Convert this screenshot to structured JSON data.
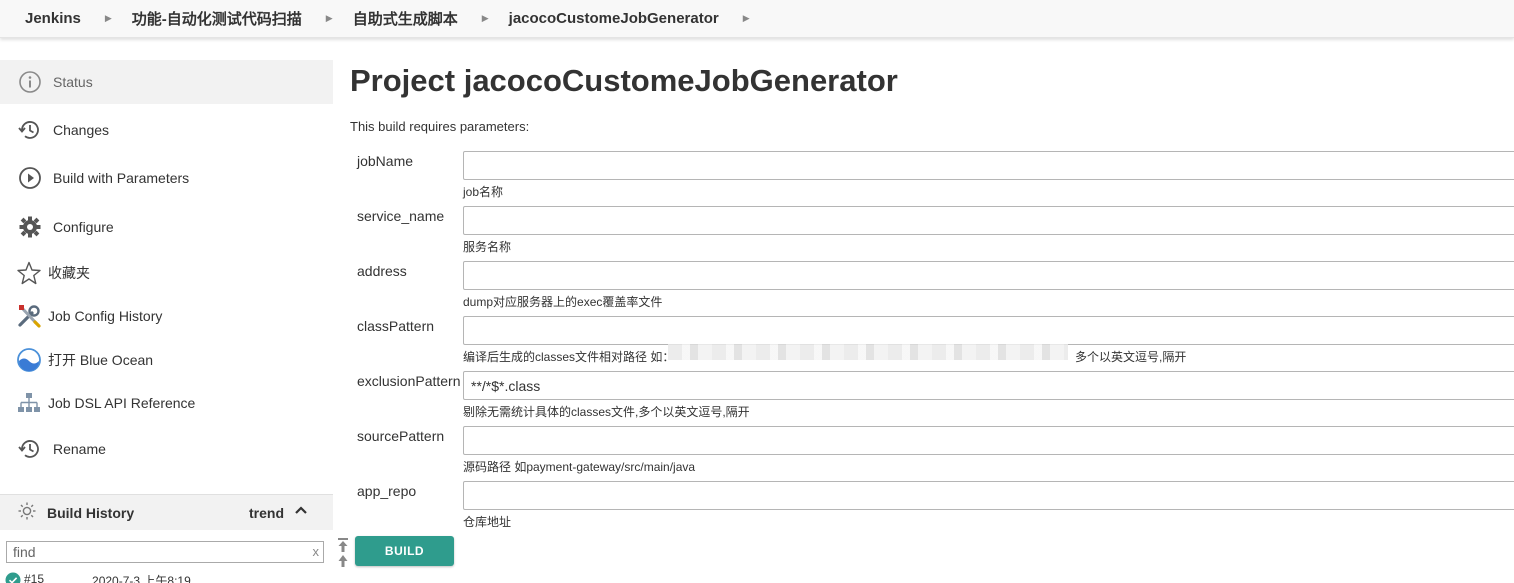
{
  "breadcrumb": {
    "items": [
      {
        "label": "Jenkins"
      },
      {
        "label": "功能-自动化测试代码扫描"
      },
      {
        "label": "自助式生成脚本"
      },
      {
        "label": "jacocoCustomeJobGenerator"
      }
    ],
    "separator_icon": "chevron-right-icon"
  },
  "sidebar": {
    "tasks": [
      {
        "label": "Status",
        "icon": "status-info-icon",
        "active": true
      },
      {
        "label": "Changes",
        "icon": "history-clock-icon"
      },
      {
        "label": "Build with Parameters",
        "icon": "play-circle-icon"
      },
      {
        "label": "Configure",
        "icon": "gear-icon"
      },
      {
        "label": "收藏夹",
        "icon": "star-icon"
      },
      {
        "label": "Job Config History",
        "icon": "tools-icon"
      },
      {
        "label": "打开 Blue Ocean",
        "icon": "blue-ocean-icon"
      },
      {
        "label": "Job DSL API Reference",
        "icon": "hierarchy-icon"
      },
      {
        "label": "Rename",
        "icon": "history-clock-icon"
      }
    ],
    "build_history": {
      "title": "Build History",
      "trend_label": "trend",
      "find_placeholder": "find",
      "clear_label": "x",
      "builds": [
        {
          "number": "#15",
          "date": "2020-7-3 上午8:19",
          "status_color": "#2f9c8d"
        }
      ]
    }
  },
  "main": {
    "title": "Project jacocoCustomeJobGenerator",
    "intro": "This build requires parameters:",
    "params": [
      {
        "name": "jobName",
        "value": "",
        "description": "job名称"
      },
      {
        "name": "service_name",
        "value": "",
        "description": "服务名称"
      },
      {
        "name": "address",
        "value": "",
        "description": "dump对应服务器上的exec覆盖率文件"
      },
      {
        "name": "classPattern",
        "value": "",
        "description": "编译后生成的classes文件相对路径 如：",
        "description_suffix": "多个以英文逗号,隔开"
      },
      {
        "name": "exclusionPattern",
        "value": "**/*$*.class",
        "description": "剔除无需统计具体的classes文件,多个以英文逗号,隔开"
      },
      {
        "name": "sourcePattern",
        "value": "",
        "description": "源码路径 如payment-gateway/src/main/java"
      },
      {
        "name": "app_repo",
        "value": "",
        "description": "仓库地址"
      }
    ],
    "build_button": "BUILD"
  },
  "colors": {
    "accent": "#2f9c8d",
    "header_bg": "#f8f8f8",
    "active_task_bg": "#f2f2f2"
  }
}
